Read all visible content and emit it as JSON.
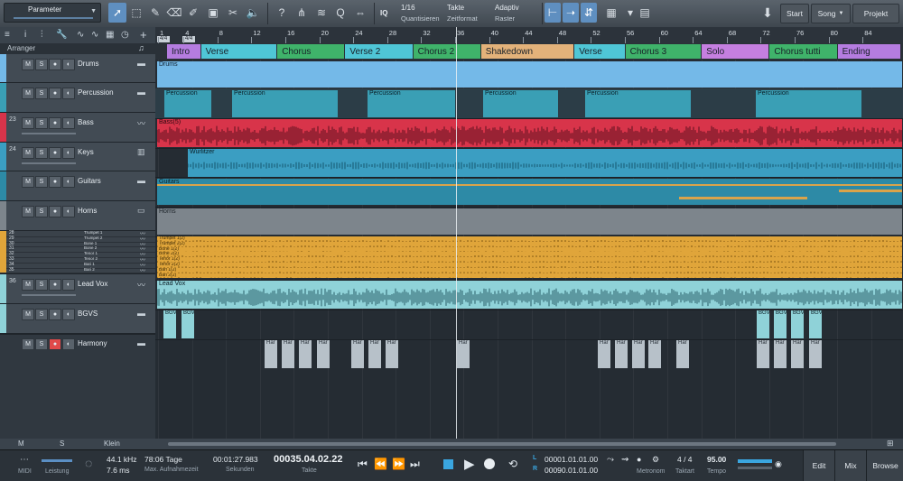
{
  "toolbar": {
    "parameter_label": "Parameter",
    "quantize_value": "1/16",
    "quantize_label": "Quantisieren",
    "timebase_value": "Takte",
    "timebase_label": "Zeitformat",
    "snap_value": "Adaptiv",
    "snap_label": "Raster",
    "iq_label": "IQ",
    "start_label": "Start",
    "song_label": "Song",
    "project_label": "Projekt"
  },
  "tracklist": {
    "arranger_label": "Arranger",
    "mute": "M",
    "solo": "S",
    "tracks": [
      {
        "name": "Drums",
        "num": ""
      },
      {
        "name": "Percussion",
        "num": ""
      },
      {
        "name": "Bass",
        "num": "23"
      },
      {
        "name": "Keys",
        "num": "24"
      },
      {
        "name": "Guitars",
        "num": ""
      },
      {
        "name": "Horns",
        "num": ""
      },
      {
        "name": "Lead Vox",
        "num": "36"
      },
      {
        "name": "BGVS",
        "num": ""
      },
      {
        "name": "Harmony",
        "num": ""
      }
    ],
    "horn_subtracks": [
      {
        "num": "28",
        "name": "Trumpet 1"
      },
      {
        "num": "29",
        "name": "Trumpet 2"
      },
      {
        "num": "30",
        "name": "Bone 1"
      },
      {
        "num": "31",
        "name": "Bone 2"
      },
      {
        "num": "32",
        "name": "Tenor 1"
      },
      {
        "num": "33",
        "name": "Tenor 2"
      },
      {
        "num": "34",
        "name": "Bari 1"
      },
      {
        "num": "35",
        "name": "Bari 2"
      }
    ]
  },
  "ruler": {
    "signature": "4/4",
    "bars": [
      "1",
      "4",
      "8",
      "12",
      "16",
      "20",
      "24",
      "28",
      "32",
      "36",
      "40",
      "44",
      "48",
      "52",
      "56",
      "60",
      "64",
      "68",
      "72",
      "76",
      "80",
      "84"
    ]
  },
  "arranger_sections": [
    {
      "label": "Intro",
      "color": "#b57ce0"
    },
    {
      "label": "Verse",
      "color": "#4fc6d6"
    },
    {
      "label": "Chorus",
      "color": "#3fb36a"
    },
    {
      "label": "Verse 2",
      "color": "#4fc6d6"
    },
    {
      "label": "Chorus 2",
      "color": "#3fb36a"
    },
    {
      "label": "Shakedown",
      "color": "#e3b27a"
    },
    {
      "label": "Verse",
      "color": "#4fc6d6"
    },
    {
      "label": "Chorus 3",
      "color": "#3fb36a"
    },
    {
      "label": "Solo",
      "color": "#c57fe0"
    },
    {
      "label": "Chorus tutti",
      "color": "#3fb36a"
    },
    {
      "label": "Ending",
      "color": "#b57ce0"
    }
  ],
  "clips": {
    "drums": "Drums",
    "percussion": "Percussion",
    "bass": "Bass(5)",
    "keys": "Wurlitzer",
    "guitars": "Guitars",
    "horns": "Horns",
    "horn_parts": [
      "Trumpet 1(2)",
      "Trumpet 2(2)",
      "Bone 1(2)",
      "Bone 2(2)",
      "Tenor 1(2)",
      "Tenor 2(2)",
      "Bari 1(2)",
      "Bari 2(2)"
    ],
    "leadvox": "Lead Vox",
    "bgvs": "BGVs",
    "harmony": "Har"
  },
  "colors": {
    "drums": "#74b9e8",
    "percussion": "#3a9fb5",
    "bass": "#d8344a",
    "keys": "#3b9ec2",
    "guitars": "#2d8aa6",
    "horns_bg": "#7d858c",
    "horns_clip": "#e0a53a",
    "leadvox": "#8fd2d8",
    "bgvs": "#8fd2d8",
    "harmony": "#b7c1c9",
    "selection_blue": "#5f8fc0",
    "record_red": "#e04a4a"
  },
  "left_foot": {
    "m": "M",
    "s": "S",
    "klein": "Klein"
  },
  "transport": {
    "midi_label": "MIDI",
    "performance_label": "Leistung",
    "sample_rate": "44.1 kHz",
    "latency": "7.6 ms",
    "record_days": "78:06 Tage",
    "record_label": "Max. Aufnahmezeit",
    "seconds": "00:01:27.983",
    "seconds_label": "Sekunden",
    "bars_position": "00035.04.02.22",
    "bars_label": "Takte",
    "loop_l_label": "L",
    "loop_r_label": "R",
    "loop_l": "00001.01.01.00",
    "loop_r": "00090.01.01.00",
    "metronome_label": "Metronom",
    "time_sig": "4 / 4",
    "time_sig_label": "Taktart",
    "tempo": "95.00",
    "tempo_label": "Tempo",
    "edit_label": "Edit",
    "mix_label": "Mix",
    "browse_label": "Browse"
  }
}
